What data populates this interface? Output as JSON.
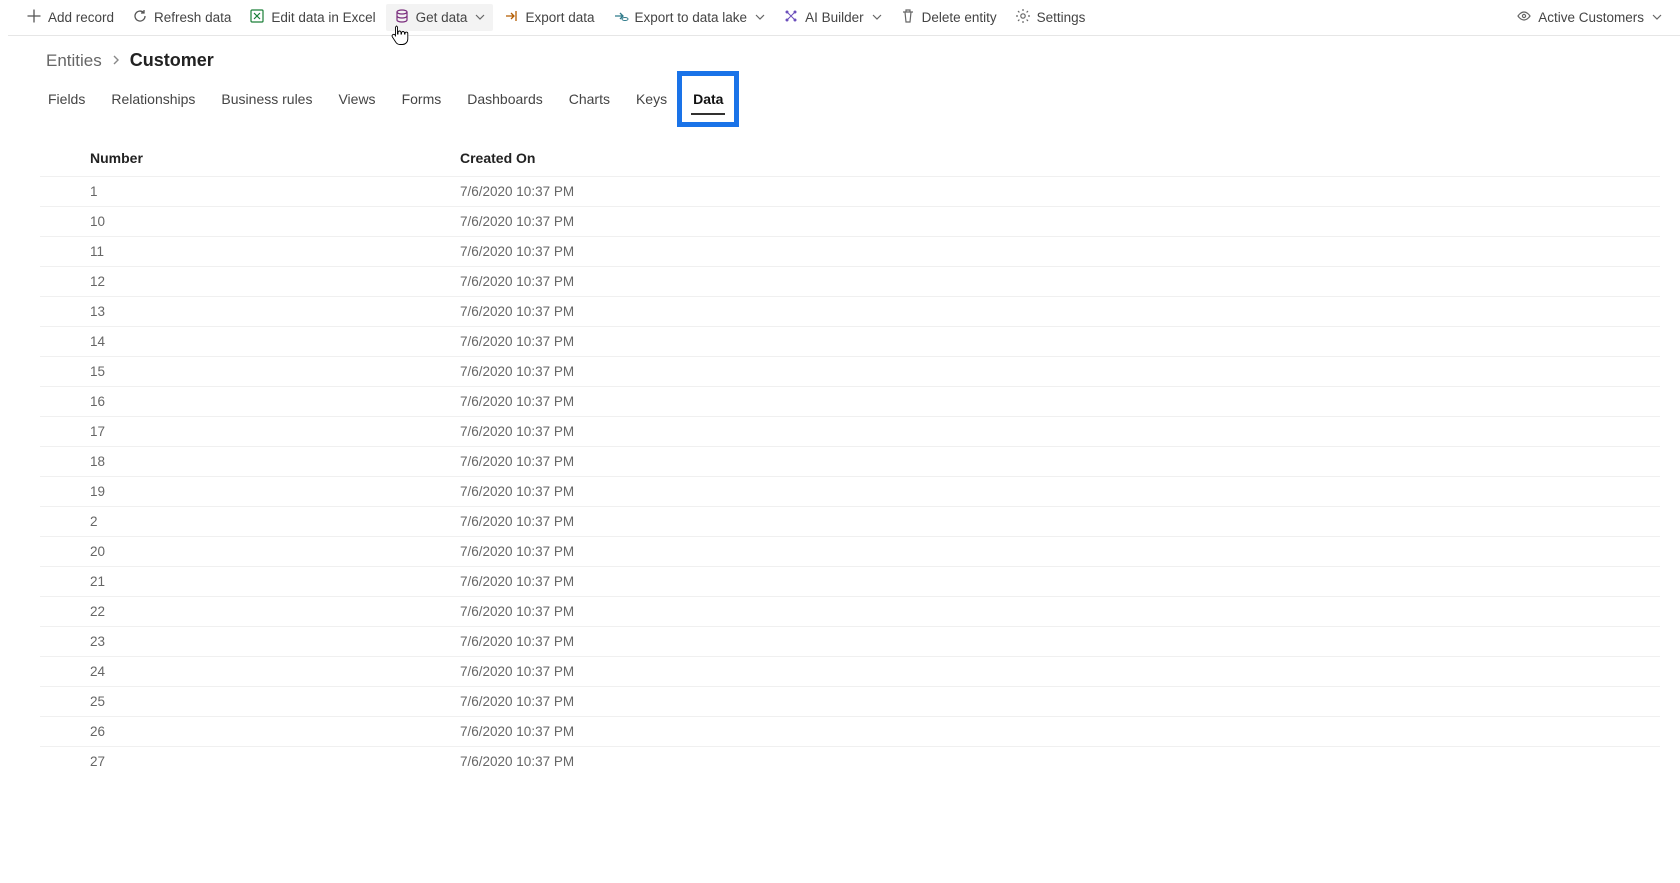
{
  "toolbar": {
    "add_record": "Add record",
    "refresh_data": "Refresh data",
    "edit_excel": "Edit data in Excel",
    "get_data": "Get data",
    "export_data": "Export data",
    "export_lake": "Export to data lake",
    "ai_builder": "AI Builder",
    "delete_entity": "Delete entity",
    "settings": "Settings",
    "active_view": "Active Customers"
  },
  "breadcrumb": {
    "root": "Entities",
    "current": "Customer"
  },
  "tabs": [
    "Fields",
    "Relationships",
    "Business rules",
    "Views",
    "Forms",
    "Dashboards",
    "Charts",
    "Keys",
    "Data"
  ],
  "active_tab": "Data",
  "table": {
    "headers": [
      "Number",
      "Created On"
    ],
    "rows": [
      {
        "number": "1",
        "created": "7/6/2020 10:37 PM"
      },
      {
        "number": "10",
        "created": "7/6/2020 10:37 PM"
      },
      {
        "number": "11",
        "created": "7/6/2020 10:37 PM"
      },
      {
        "number": "12",
        "created": "7/6/2020 10:37 PM"
      },
      {
        "number": "13",
        "created": "7/6/2020 10:37 PM"
      },
      {
        "number": "14",
        "created": "7/6/2020 10:37 PM"
      },
      {
        "number": "15",
        "created": "7/6/2020 10:37 PM"
      },
      {
        "number": "16",
        "created": "7/6/2020 10:37 PM"
      },
      {
        "number": "17",
        "created": "7/6/2020 10:37 PM"
      },
      {
        "number": "18",
        "created": "7/6/2020 10:37 PM"
      },
      {
        "number": "19",
        "created": "7/6/2020 10:37 PM"
      },
      {
        "number": "2",
        "created": "7/6/2020 10:37 PM"
      },
      {
        "number": "20",
        "created": "7/6/2020 10:37 PM"
      },
      {
        "number": "21",
        "created": "7/6/2020 10:37 PM"
      },
      {
        "number": "22",
        "created": "7/6/2020 10:37 PM"
      },
      {
        "number": "23",
        "created": "7/6/2020 10:37 PM"
      },
      {
        "number": "24",
        "created": "7/6/2020 10:37 PM"
      },
      {
        "number": "25",
        "created": "7/6/2020 10:37 PM"
      },
      {
        "number": "26",
        "created": "7/6/2020 10:37 PM"
      },
      {
        "number": "27",
        "created": "7/6/2020 10:37 PM"
      }
    ]
  }
}
